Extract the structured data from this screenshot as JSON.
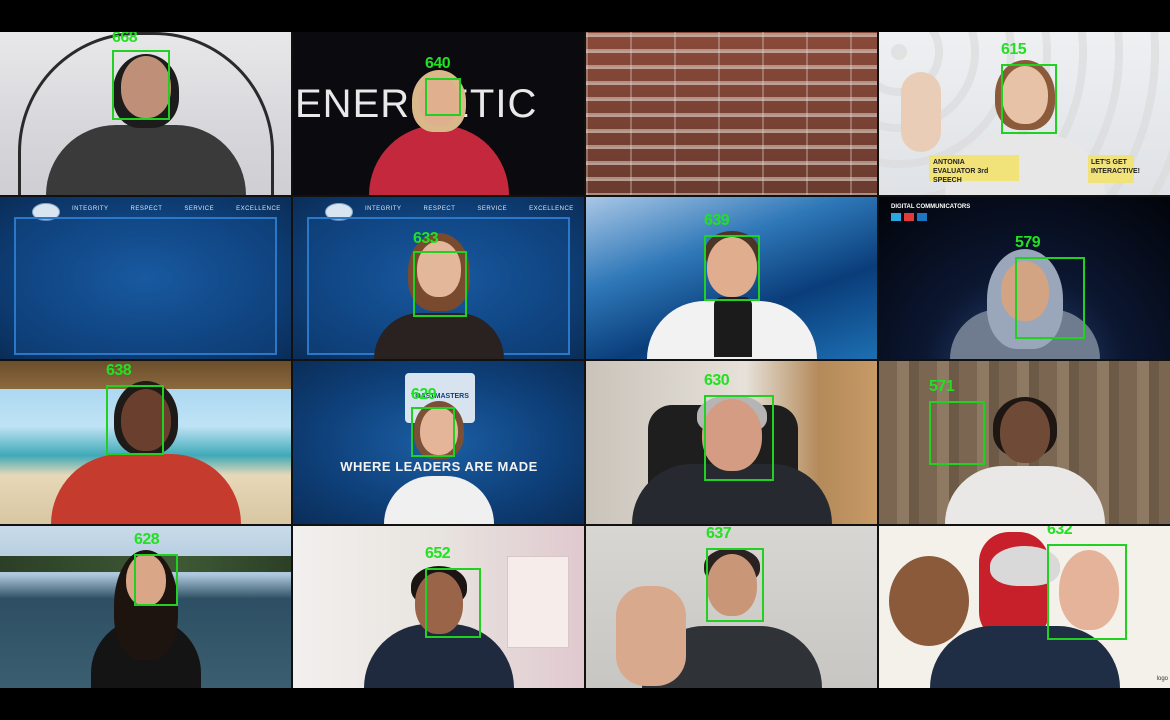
{
  "meeting": {
    "tiles": [
      {
        "id": "668"
      },
      {
        "id": "640",
        "background_word": "ENERGETIC"
      },
      {
        "id": ""
      },
      {
        "id": "615",
        "badge_name": "ANTONIA",
        "badge_role": "EVALUATOR 3rd SPEECH",
        "badge_cta": "LET'S GET INTERACTIVE!"
      },
      {
        "id": "",
        "banner": [
          "INTEGRITY",
          "RESPECT",
          "SERVICE",
          "EXCELLENCE"
        ]
      },
      {
        "id": "633",
        "banner": [
          "INTEGRITY",
          "RESPECT",
          "SERVICE",
          "EXCELLENCE"
        ]
      },
      {
        "id": "639"
      },
      {
        "id": "579",
        "logo_text": "DIGITAL COMMUNICATORS"
      },
      {
        "id": "638"
      },
      {
        "id": "629",
        "caption": "WHERE LEADERS ARE MADE",
        "logo_text": "TOASTMASTERS"
      },
      {
        "id": "630"
      },
      {
        "id": "571"
      },
      {
        "id": "628"
      },
      {
        "id": "652"
      },
      {
        "id": "637"
      },
      {
        "id": "632",
        "corner_text": "logo"
      }
    ]
  },
  "colors": {
    "detection_box": "#22d022",
    "detection_label": "#22e022",
    "background": "#000000"
  }
}
